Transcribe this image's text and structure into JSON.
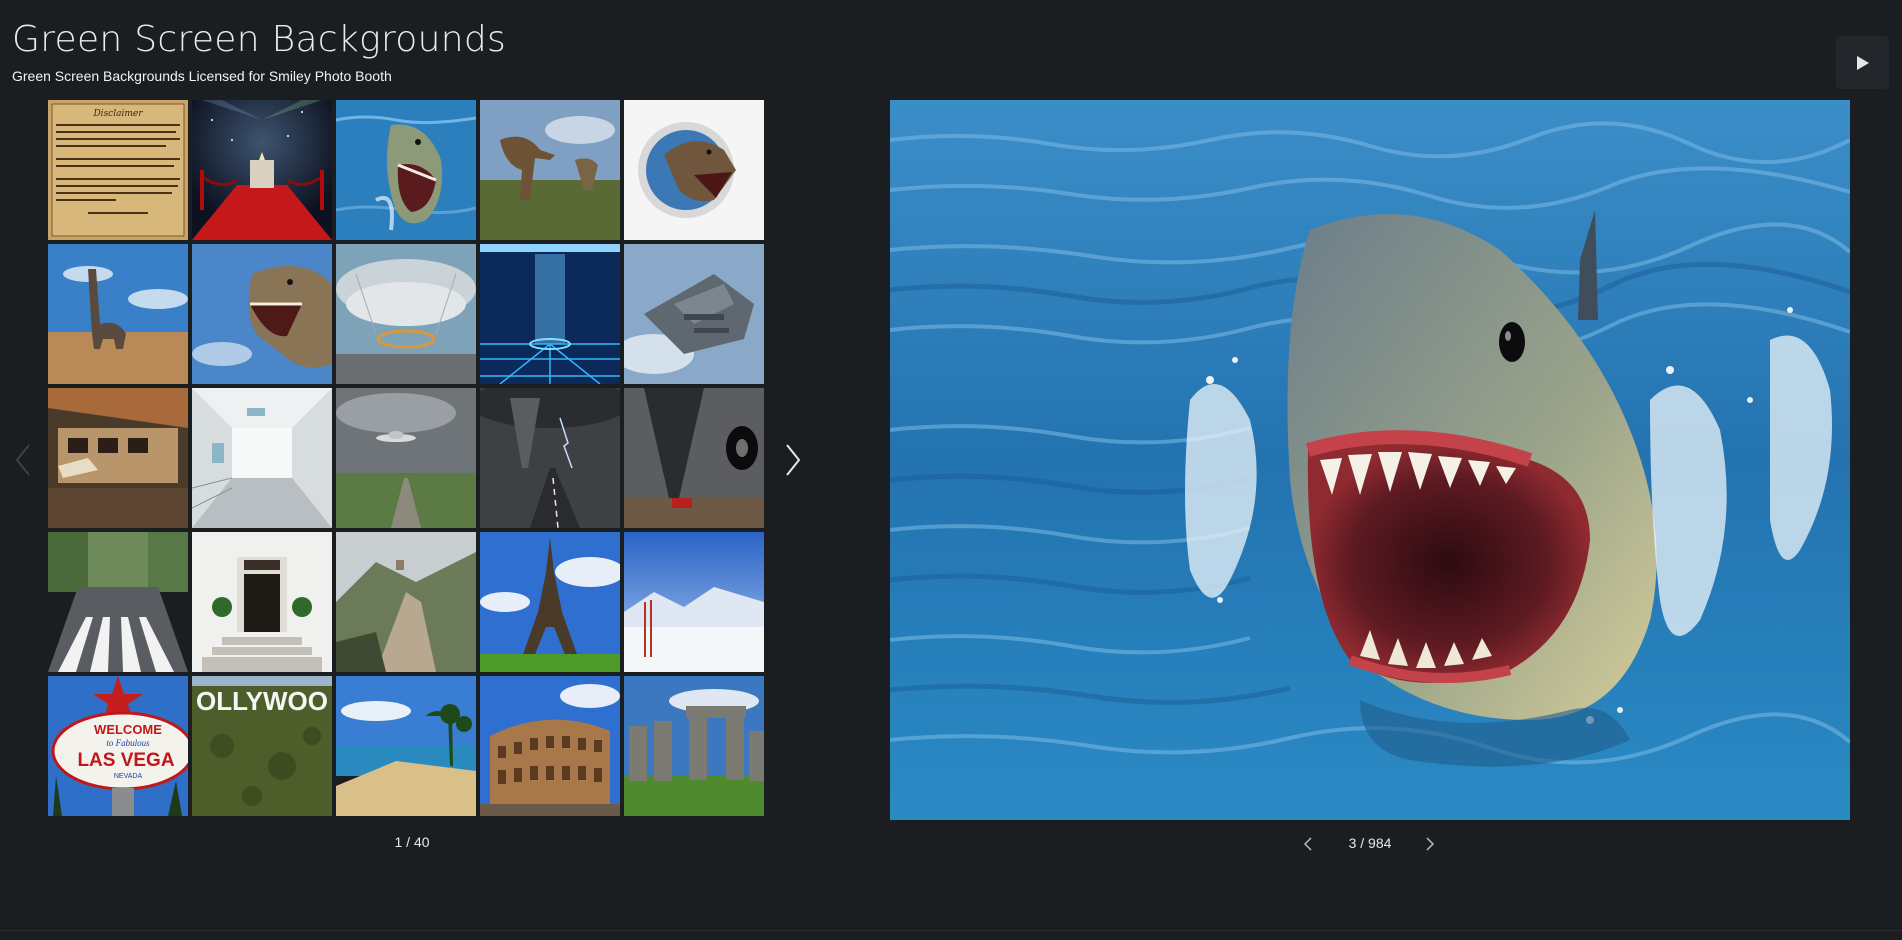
{
  "header": {
    "title": "Green Screen Backgrounds",
    "subtitle": "Green Screen Backgrounds Licensed for Smiley Photo Booth"
  },
  "controls": {
    "play_icon": "play-icon",
    "grid_prev_icon": "chevron-left-icon",
    "grid_next_icon": "chevron-right-icon"
  },
  "thumbnails": {
    "page_counter": "1 / 40",
    "items": [
      {
        "subject": "disclaimer"
      },
      {
        "subject": "red-carpet"
      },
      {
        "subject": "shark"
      },
      {
        "subject": "t-rex-herd"
      },
      {
        "subject": "t-rex-breakthrough"
      },
      {
        "subject": "brachiosaurus"
      },
      {
        "subject": "t-rex-sky"
      },
      {
        "subject": "spaceship-interior"
      },
      {
        "subject": "sci-fi-chamber"
      },
      {
        "subject": "spaceship"
      },
      {
        "subject": "train"
      },
      {
        "subject": "white-corridor"
      },
      {
        "subject": "ufo"
      },
      {
        "subject": "tornado-road"
      },
      {
        "subject": "tornado-tire"
      },
      {
        "subject": "abbey-road"
      },
      {
        "subject": "doorway"
      },
      {
        "subject": "great-wall"
      },
      {
        "subject": "eiffel-tower"
      },
      {
        "subject": "snow-mountains"
      },
      {
        "subject": "las-vegas-sign"
      },
      {
        "subject": "hollywood-sign"
      },
      {
        "subject": "beach"
      },
      {
        "subject": "colosseum"
      },
      {
        "subject": "stonehenge"
      }
    ],
    "disclaimer_heading": "Disclaimer",
    "hollywood_text": "OLLYWOO",
    "vegas_welcome": "WELCOME",
    "vegas_fabulous": "to Fabulous",
    "vegas_city": "LAS VEGA",
    "vegas_state": "NEVADA"
  },
  "viewer": {
    "counter": "3 / 984",
    "prev_icon": "chevron-left-icon",
    "next_icon": "chevron-right-icon",
    "subject": "shark"
  },
  "colors": {
    "background": "#1b1e21",
    "button_bg": "#23272b",
    "water": "#2a7bb5"
  }
}
